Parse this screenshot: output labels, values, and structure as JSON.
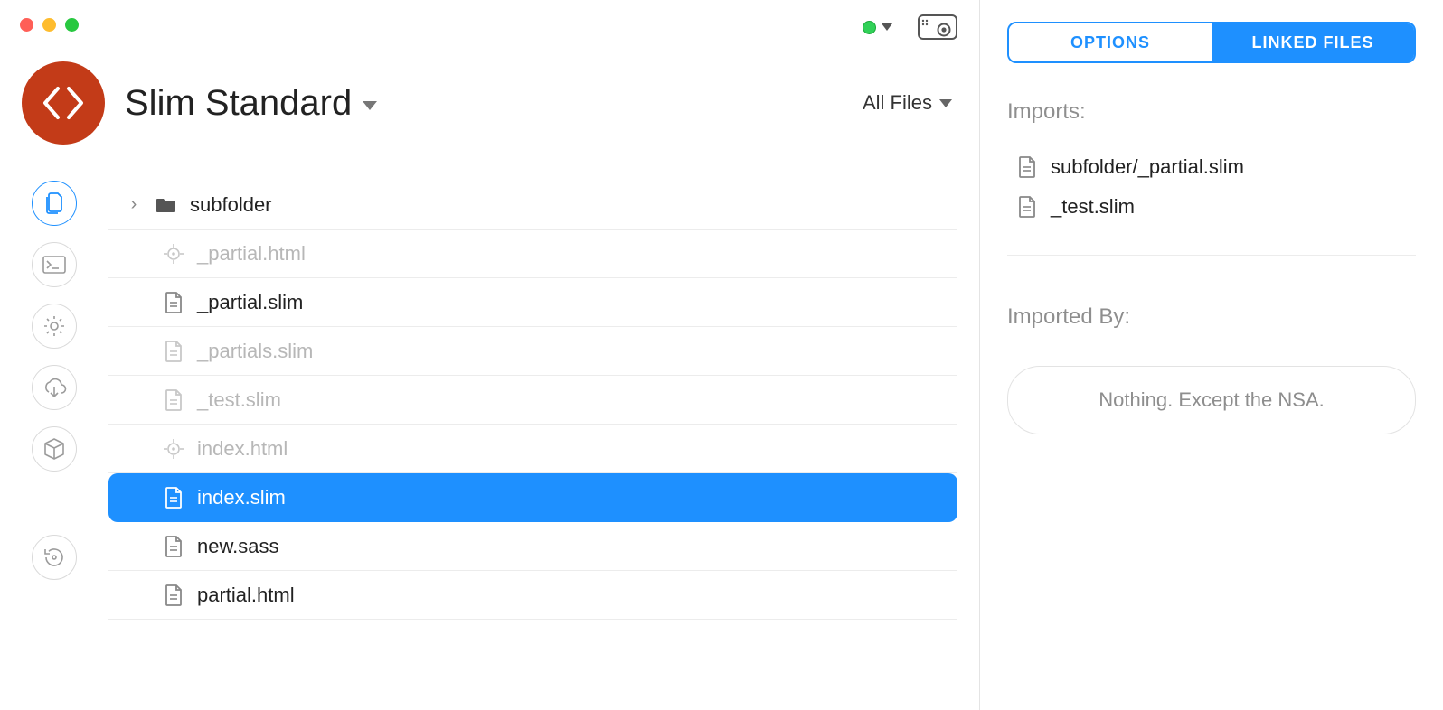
{
  "project": {
    "title": "Slim Standard"
  },
  "filter": {
    "label": "All Files"
  },
  "nav": {
    "items": [
      "files",
      "terminal",
      "settings",
      "cloud",
      "package",
      "history"
    ],
    "active": "files"
  },
  "files": [
    {
      "name": "subfolder",
      "type": "folder",
      "dimmed": false,
      "selected": false
    },
    {
      "name": "_partial.html",
      "type": "target",
      "dimmed": true,
      "selected": false
    },
    {
      "name": "_partial.slim",
      "type": "doc",
      "dimmed": false,
      "selected": false
    },
    {
      "name": "_partials.slim",
      "type": "doc",
      "dimmed": true,
      "selected": false
    },
    {
      "name": "_test.slim",
      "type": "doc",
      "dimmed": true,
      "selected": false
    },
    {
      "name": "index.html",
      "type": "target",
      "dimmed": true,
      "selected": false
    },
    {
      "name": "index.slim",
      "type": "doc",
      "dimmed": false,
      "selected": true
    },
    {
      "name": "new.sass",
      "type": "doc",
      "dimmed": false,
      "selected": false
    },
    {
      "name": "partial.html",
      "type": "doc",
      "dimmed": false,
      "selected": false
    }
  ],
  "sidebar": {
    "tabs": {
      "options": "OPTIONS",
      "linked": "LINKED FILES",
      "active": "linked"
    },
    "imports_label": "Imports:",
    "imports": [
      {
        "name": "subfolder/_partial.slim"
      },
      {
        "name": "_test.slim"
      }
    ],
    "imported_by_label": "Imported By:",
    "empty_text": "Nothing. Except the NSA."
  }
}
